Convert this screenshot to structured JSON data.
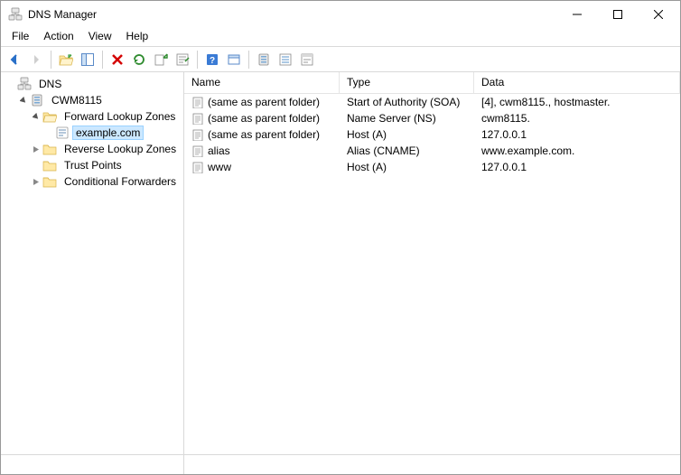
{
  "window": {
    "title": "DNS Manager"
  },
  "menu": {
    "file": "File",
    "action": "Action",
    "view": "View",
    "help": "Help"
  },
  "tree": {
    "root": "DNS",
    "server": "CWM8115",
    "nodes": {
      "fwd": "Forward Lookup Zones",
      "zone": "example.com",
      "rev": "Reverse Lookup Zones",
      "trust": "Trust Points",
      "cond": "Conditional Forwarders"
    }
  },
  "list": {
    "cols": {
      "name": "Name",
      "type": "Type",
      "data": "Data"
    },
    "rows": [
      {
        "name": "(same as parent folder)",
        "type": "Start of Authority (SOA)",
        "data": "[4], cwm8115., hostmaster."
      },
      {
        "name": "(same as parent folder)",
        "type": "Name Server (NS)",
        "data": "cwm8115."
      },
      {
        "name": "(same as parent folder)",
        "type": "Host (A)",
        "data": "127.0.0.1"
      },
      {
        "name": "alias",
        "type": "Alias (CNAME)",
        "data": "www.example.com."
      },
      {
        "name": "www",
        "type": "Host (A)",
        "data": "127.0.0.1"
      }
    ]
  }
}
